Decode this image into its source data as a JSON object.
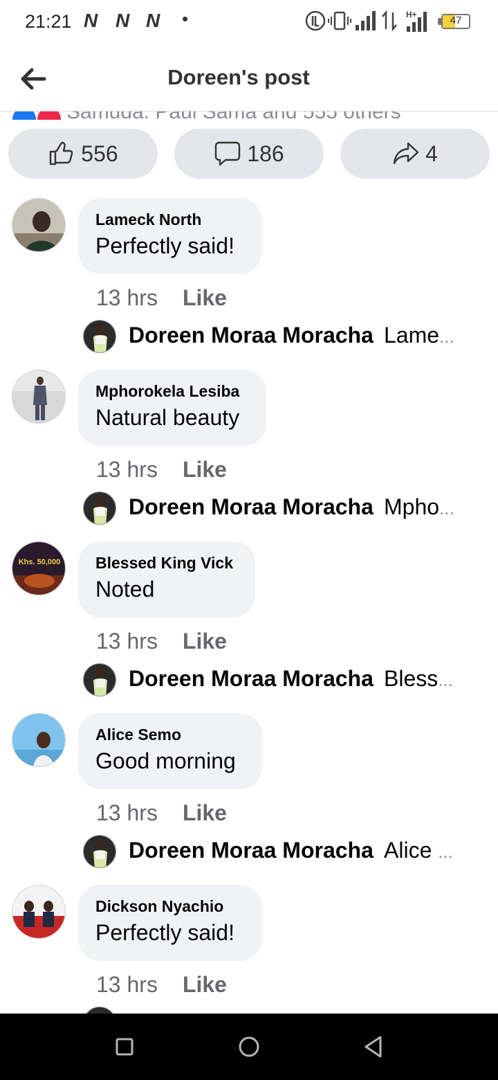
{
  "status_bar": {
    "time": "21:21",
    "notification_icons": [
      "N",
      "N",
      "N"
    ],
    "dot": "•",
    "icons": [
      "volte-icon",
      "vibrate-icon",
      "signal-icon",
      "data-arrows-icon",
      "hplus-signal-icon"
    ],
    "hplus_label": "H+",
    "battery_level": "47"
  },
  "header": {
    "title": "Doreen's post"
  },
  "reactions_summary": {
    "text": "Samuda. Paul Sama and 555 others"
  },
  "actions": {
    "like_count": "556",
    "comment_count": "186",
    "share_count": "4"
  },
  "comments": [
    {
      "name": "Lameck North",
      "text": "Perfectly said!",
      "time": "13 hrs",
      "like_label": "Like",
      "reply": {
        "name": "Doreen Moraa Moracha",
        "snippet": "Lame",
        "ellipsis": "..."
      }
    },
    {
      "name": "Mphorokela Lesiba",
      "text": "Natural beauty",
      "time": "13 hrs",
      "like_label": "Like",
      "reply": {
        "name": "Doreen Moraa Moracha",
        "snippet": "Mpho",
        "ellipsis": "..."
      }
    },
    {
      "name": "Blessed King Vick",
      "text": "Noted",
      "time": "13 hrs",
      "like_label": "Like",
      "avatar_text": "Khs. 50,000",
      "reply": {
        "name": "Doreen Moraa Moracha",
        "snippet": "Bless",
        "ellipsis": "..."
      }
    },
    {
      "name": "Alice Semo",
      "text": "Good morning",
      "time": "13 hrs",
      "like_label": "Like",
      "reply": {
        "name": "Doreen Moraa Moracha",
        "snippet": "Alice ",
        "ellipsis": "..."
      }
    },
    {
      "name": "Dickson Nyachio",
      "text": "Perfectly said!",
      "time": "13 hrs",
      "like_label": "Like"
    }
  ],
  "nav": {
    "icons": [
      "recent-apps-icon",
      "home-icon",
      "back-icon"
    ]
  }
}
